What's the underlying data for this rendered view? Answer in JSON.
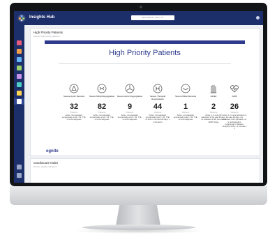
{
  "app": {
    "title": "Insights Hub",
    "search_placeholder": "Find patients, visits, etc."
  },
  "page": {
    "title": "High Priority Patients",
    "subtitle": "Identify high priority patients"
  },
  "dashboard": {
    "heading": "High Priority Patients",
    "brand": "egnite",
    "count_unit": "Patients"
  },
  "conditions": [
    {
      "icon": "valve-icon",
      "name": "Severe Aortic Stenosis",
      "count": "32",
      "unit": "Patients",
      "description": "Active, not evaluated, symptomatic or EF < 50. TTE: ≥3 echo diagnosis"
    },
    {
      "icon": "valve-icon",
      "name": "Severe Mitral Regurgitation",
      "count": "82",
      "unit": "Patients",
      "description": "Active, not evaluated, symptomatic or EF < 60. TTE: ≥3 echo diagnosis"
    },
    {
      "icon": "valve-icon",
      "name": "Severe Aortic Regurgitation",
      "count": "9",
      "unit": "Patients",
      "description": "Active, not evaluated, symptomatic or EF < 50. TTE: ≥3 echo diagnosis"
    },
    {
      "icon": "valve-icon",
      "name": "Severe Tricuspid Regurgitation",
      "count": "44",
      "unit": "Patients",
      "description": "Active, not evaluated, symptomatic or EF < 50. TTE: ≥3 echo in the last 180 days, ≥ 1 risk factor"
    },
    {
      "icon": "valve-icon",
      "name": "Severe Mitral Stenosis",
      "count": "1",
      "unit": "Patients",
      "description": "Active, not evaluated, symptomatic or EF < 50. TTE: ≥3 echo diagnosis"
    },
    {
      "icon": "hand-icon",
      "name": "HFrEF",
      "count": "2",
      "unit": "Patients",
      "description": "Active, 2 or more HF admission in the past 90 days, no evaluated in EP, less than 3 GDMT drugs"
    },
    {
      "icon": "heartbeat-icon",
      "name": "AFIB",
      "count": "26",
      "unit": "Patients",
      "description": "Active, 1 or more admission in the past 90 days, not evaluated in EP specialist, not on anticoagulant, hypertension, diabetes, CHA₂DS₂-VASc ≥ 2, Female ≥ 3"
    }
  ],
  "second_panel": {
    "title": "CardioCare Index",
    "subtitle": "Monitor quality indicators"
  },
  "colors": {
    "navy": "#1d2f6b",
    "accent": "#2e3a8c"
  }
}
